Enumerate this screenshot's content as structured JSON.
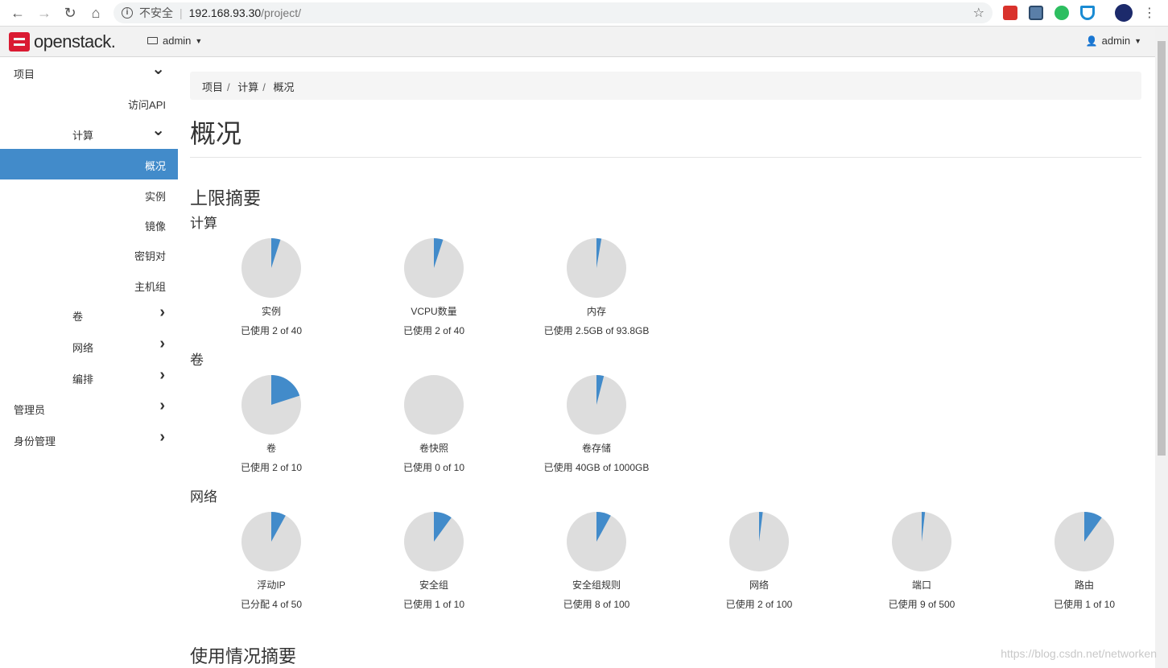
{
  "browser": {
    "security_label": "不安全",
    "host": "192.168.93.30",
    "path": "/project/"
  },
  "header": {
    "logo_text": "openstack.",
    "project_label": "admin",
    "user_label": "admin"
  },
  "sidebar": {
    "items": [
      {
        "label": "项目",
        "level": 0,
        "chevron": "down"
      },
      {
        "label": "访问API",
        "level": 2,
        "chevron": ""
      },
      {
        "label": "计算",
        "level": 1,
        "chevron": "down"
      },
      {
        "label": "概况",
        "level": 2,
        "chevron": "",
        "active": true
      },
      {
        "label": "实例",
        "level": 2,
        "chevron": ""
      },
      {
        "label": "镜像",
        "level": 2,
        "chevron": ""
      },
      {
        "label": "密钥对",
        "level": 2,
        "chevron": ""
      },
      {
        "label": "主机组",
        "level": 2,
        "chevron": ""
      },
      {
        "label": "卷",
        "level": 1,
        "chevron": "right"
      },
      {
        "label": "网络",
        "level": 1,
        "chevron": "right"
      },
      {
        "label": "编排",
        "level": 1,
        "chevron": "right"
      },
      {
        "label": "管理员",
        "level": 0,
        "chevron": "right"
      },
      {
        "label": "身份管理",
        "level": 0,
        "chevron": "right"
      }
    ]
  },
  "breadcrumb": [
    "项目",
    "计算",
    "概况"
  ],
  "page_title": "概况",
  "limit_summary_title": "上限摘要",
  "usage_summary_title": "使用情况摘要",
  "colors": {
    "used": "#428bca",
    "free": "#dddddd",
    "active": "#428bca"
  },
  "groups": [
    {
      "title": "计算",
      "charts": [
        {
          "label": "实例",
          "used_text": "已使用 2 of 40",
          "fraction": 0.05
        },
        {
          "label": "VCPU数量",
          "used_text": "已使用 2 of 40",
          "fraction": 0.05
        },
        {
          "label": "内存",
          "used_text": "已使用 2.5GB of 93.8GB",
          "fraction": 0.0267
        }
      ]
    },
    {
      "title": "卷",
      "charts": [
        {
          "label": "卷",
          "used_text": "已使用 2 of 10",
          "fraction": 0.2
        },
        {
          "label": "卷快照",
          "used_text": "已使用 0 of 10",
          "fraction": 0
        },
        {
          "label": "卷存储",
          "used_text": "已使用 40GB of 1000GB",
          "fraction": 0.04
        }
      ]
    },
    {
      "title": "网络",
      "charts": [
        {
          "label": "浮动IP",
          "used_text": "已分配 4 of 50",
          "fraction": 0.08
        },
        {
          "label": "安全组",
          "used_text": "已使用 1 of 10",
          "fraction": 0.1
        },
        {
          "label": "安全组规则",
          "used_text": "已使用 8 of 100",
          "fraction": 0.08
        },
        {
          "label": "网络",
          "used_text": "已使用 2 of 100",
          "fraction": 0.02
        },
        {
          "label": "端口",
          "used_text": "已使用 9 of 500",
          "fraction": 0.018
        },
        {
          "label": "路由",
          "used_text": "已使用 1 of 10",
          "fraction": 0.1
        }
      ]
    }
  ],
  "watermark": "https://blog.csdn.net/networken"
}
